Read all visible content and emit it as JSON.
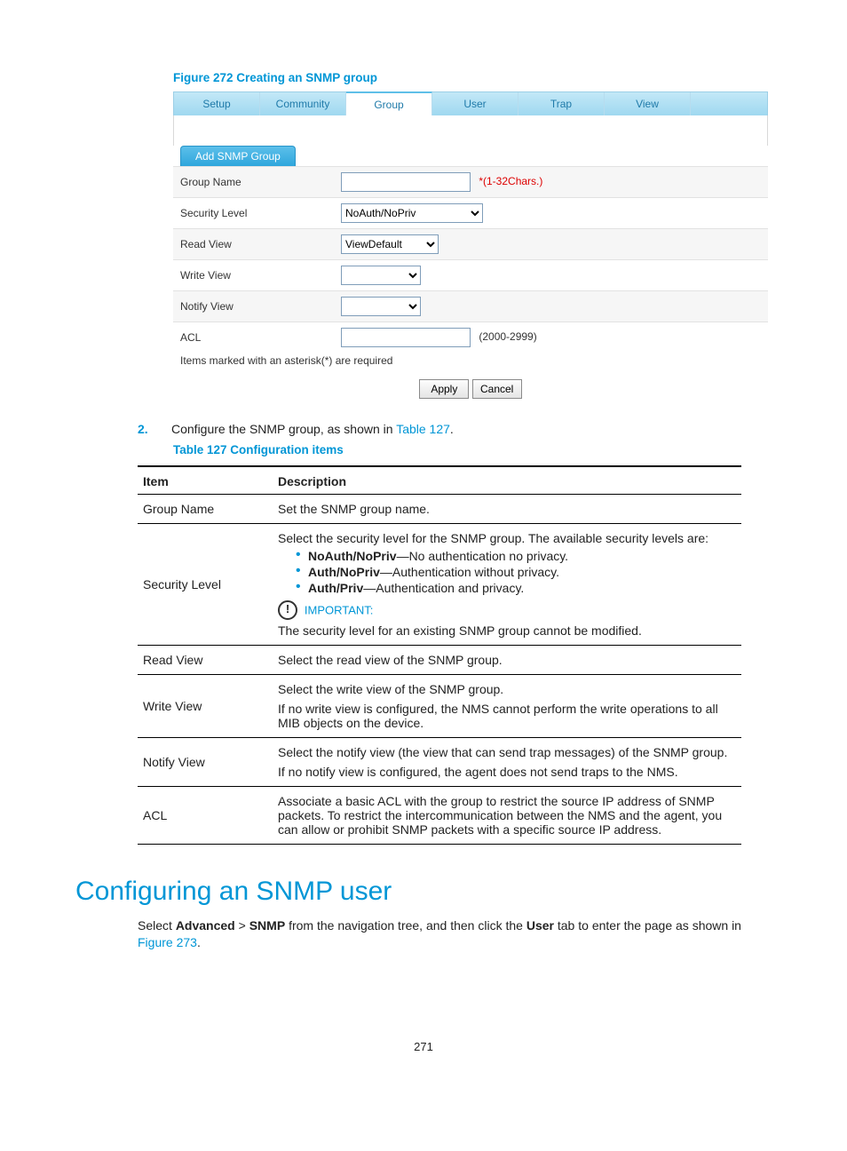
{
  "figure_caption": "Figure 272 Creating an SNMP group",
  "tabs": [
    "Setup",
    "Community",
    "Group",
    "User",
    "Trap",
    "View"
  ],
  "active_tab_index": 2,
  "panel_title": "Add SNMP Group",
  "form": {
    "rows": {
      "group_name": {
        "label": "Group Name",
        "hint": "*(1-32Chars.)"
      },
      "security_level": {
        "label": "Security Level",
        "value": "NoAuth/NoPriv"
      },
      "read_view": {
        "label": "Read View",
        "value": "ViewDefault"
      },
      "write_view": {
        "label": "Write View",
        "value": ""
      },
      "notify_view": {
        "label": "Notify View",
        "value": ""
      },
      "acl": {
        "label": "ACL",
        "hint": "(2000-2999)"
      }
    },
    "note": "Items marked with an asterisk(*) are required",
    "apply": "Apply",
    "cancel": "Cancel"
  },
  "step": {
    "number": "2.",
    "text_before": "Configure the SNMP group, as shown in ",
    "link": "Table 127",
    "text_after": "."
  },
  "table_caption": "Table 127 Configuration items",
  "cfg": {
    "headers": [
      "Item",
      "Description"
    ],
    "rows": {
      "group_name": {
        "item": "Group Name",
        "desc": "Set the SNMP group name."
      },
      "security_level": {
        "item": "Security Level",
        "intro": "Select the security level for the SNMP group. The available security levels are:",
        "bullets": [
          {
            "b": "NoAuth/NoPriv",
            "t": "—No authentication no privacy."
          },
          {
            "b": "Auth/NoPriv",
            "t": "—Authentication without privacy."
          },
          {
            "b": "Auth/Priv",
            "t": "—Authentication and privacy."
          }
        ],
        "important_label": "IMPORTANT:",
        "important_text": "The security level for an existing SNMP group cannot be modified."
      },
      "read_view": {
        "item": "Read View",
        "desc": "Select the read view of the SNMP group."
      },
      "write_view": {
        "item": "Write View",
        "p1": "Select the write view of the SNMP group.",
        "p2": "If no write view is configured, the NMS cannot perform the write operations to all MIB objects on the device."
      },
      "notify_view": {
        "item": "Notify View",
        "p1": "Select the notify view (the view that can send trap messages) of the SNMP group.",
        "p2": "If no notify view is configured, the agent does not send traps to the NMS."
      },
      "acl": {
        "item": "ACL",
        "desc": "Associate a basic ACL with the group to restrict the source IP address of SNMP packets. To restrict the intercommunication between the NMS and the agent, you can allow or prohibit SNMP packets with a specific source IP address."
      }
    }
  },
  "section_heading": "Configuring an SNMP user",
  "section_para": {
    "t1": "Select ",
    "b1": "Advanced",
    "t2": " > ",
    "b2": "SNMP",
    "t3": " from the navigation tree, and then click the ",
    "b3": "User",
    "t4": " tab to enter the page as shown in ",
    "link": "Figure 273",
    "t5": "."
  },
  "page_number": "271"
}
